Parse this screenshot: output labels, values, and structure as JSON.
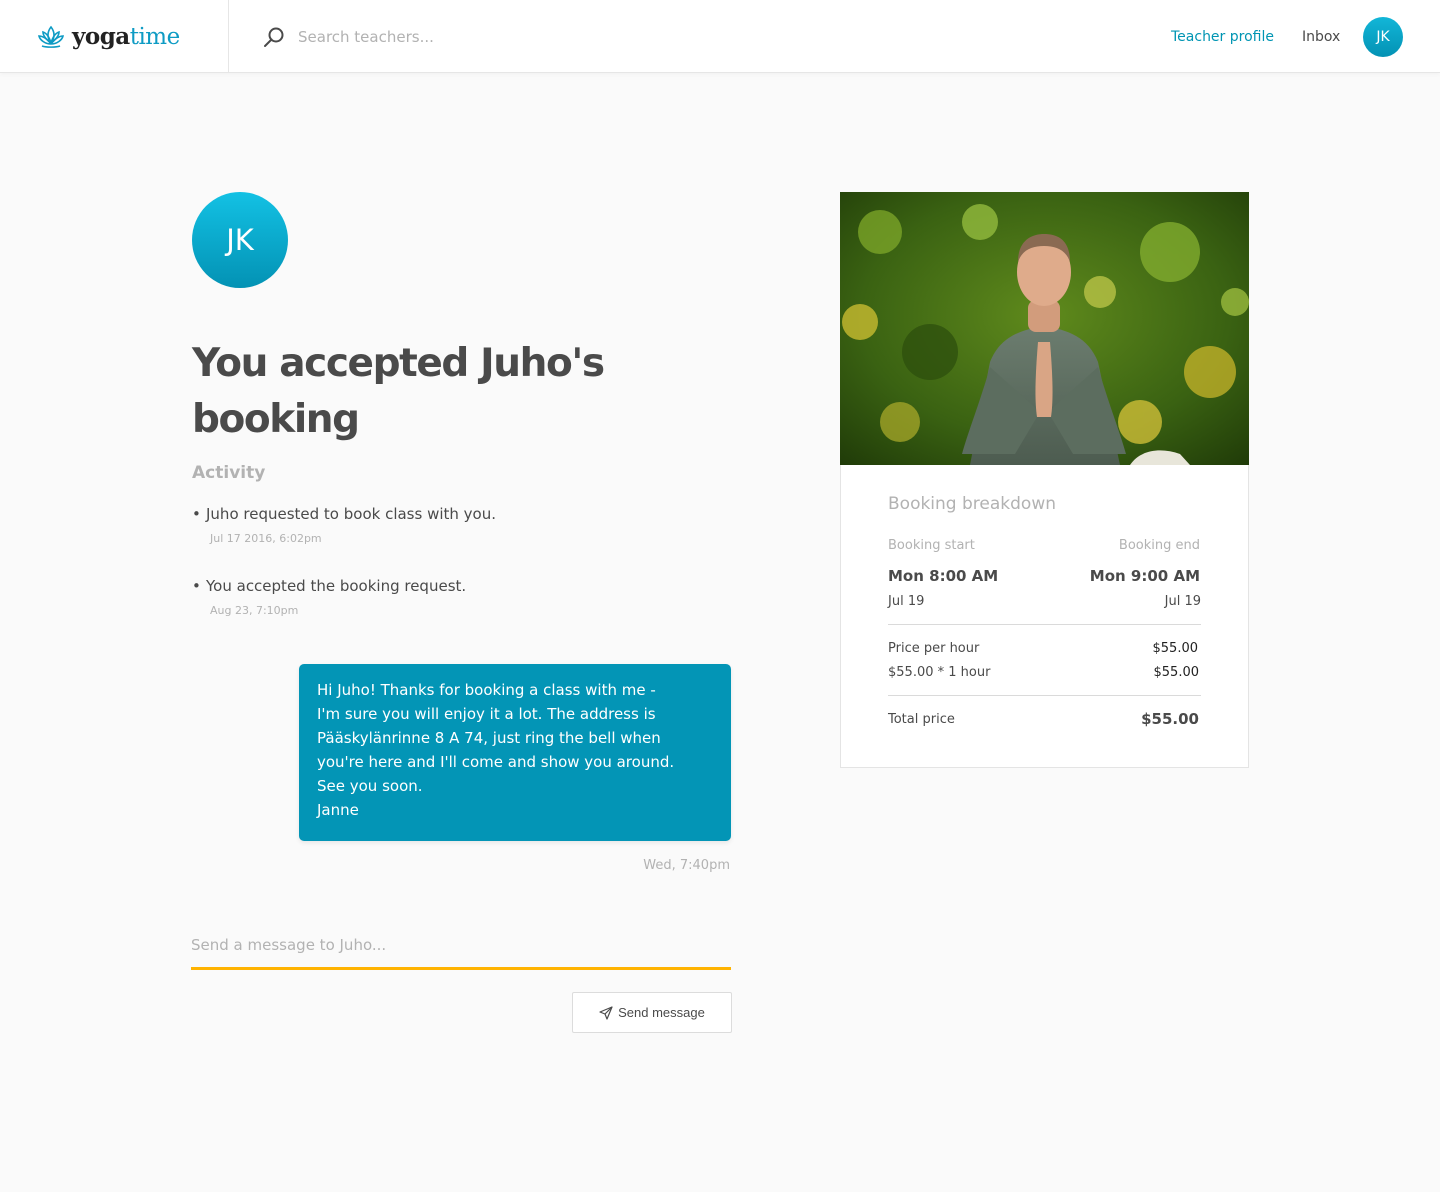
{
  "brand": {
    "name_part1": "yoga",
    "name_part2": "time",
    "accent": "#0e9bc4"
  },
  "search": {
    "placeholder": "Search teachers..."
  },
  "nav": {
    "teacher_profile": "Teacher profile",
    "inbox": "Inbox",
    "user_initials": "JK"
  },
  "page": {
    "avatar_initials": "JK",
    "title": "You accepted Juho's booking",
    "activity_heading": "Activity",
    "activity": [
      {
        "text": "Juho requested to book class with you.",
        "date": "Jul 17 2016, 6:02pm"
      },
      {
        "text": "You accepted the booking request.",
        "date": "Aug 23, 7:10pm"
      }
    ],
    "message": {
      "text": "Hi Juho! Thanks for booking a class with me -\nI'm sure you will enjoy it a lot. The address is\nPääskylänrinne 8 A 74, just ring the bell when\nyou're here and I'll come and show you around.\nSee you soon.\nJanne",
      "time": "Wed, 7:40pm",
      "bubble_color": "#0395b6"
    },
    "compose": {
      "placeholder": "Send a message to Juho...",
      "send_label": "Send message",
      "underline_color": "#ffb300"
    }
  },
  "breakdown": {
    "title": "Booking breakdown",
    "start_label": "Booking start",
    "end_label": "Booking end",
    "start_time": "Mon 8:00 AM",
    "end_time": "Mon 9:00 AM",
    "start_date": "Jul 19",
    "end_date": "Jul 19",
    "price_per_hour_label": "Price per hour",
    "price_per_hour": "$55.00",
    "calc_label": "$55.00 * 1 hour",
    "calc_value": "$55.00",
    "total_label": "Total price",
    "total_value": "$55.00"
  }
}
